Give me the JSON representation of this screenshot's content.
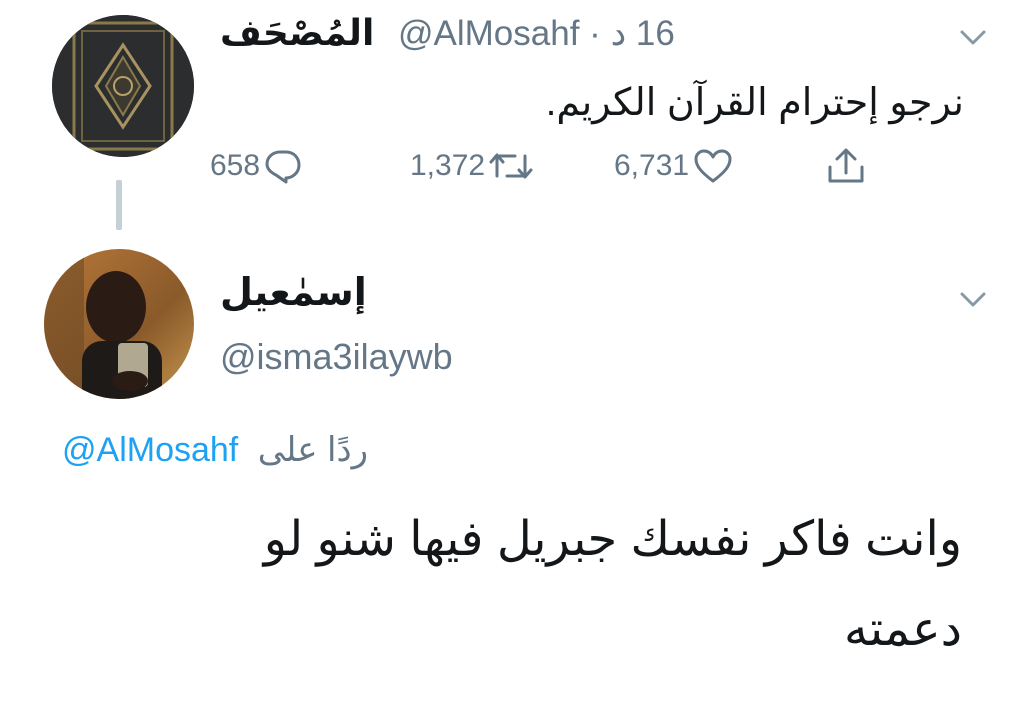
{
  "tweet1": {
    "display_name": "المُصْحَف",
    "handle": "@AlMosahf",
    "time": "16 د",
    "separator": "·",
    "text": "نرجو إحترام القرآن الكريم.",
    "reply_count": "658",
    "retweet_count": "1,372",
    "like_count": "6,731"
  },
  "tweet2": {
    "display_name": "إسمٰعيل",
    "handle": "@isma3ilaywb",
    "replying_prefix": "ردًا على",
    "replying_to": "@AlMosahf",
    "text_line1": "وانت فاكر نفسك جبريل فيها شنو لو",
    "text_line2": "دعمته"
  },
  "colors": {
    "text": "#14171a",
    "secondary": "#657786",
    "link": "#1da1f2",
    "thread_line": "#c4cfd6"
  },
  "icons": [
    "reply-icon",
    "retweet-icon",
    "like-icon",
    "share-icon",
    "chevron-down-icon"
  ]
}
